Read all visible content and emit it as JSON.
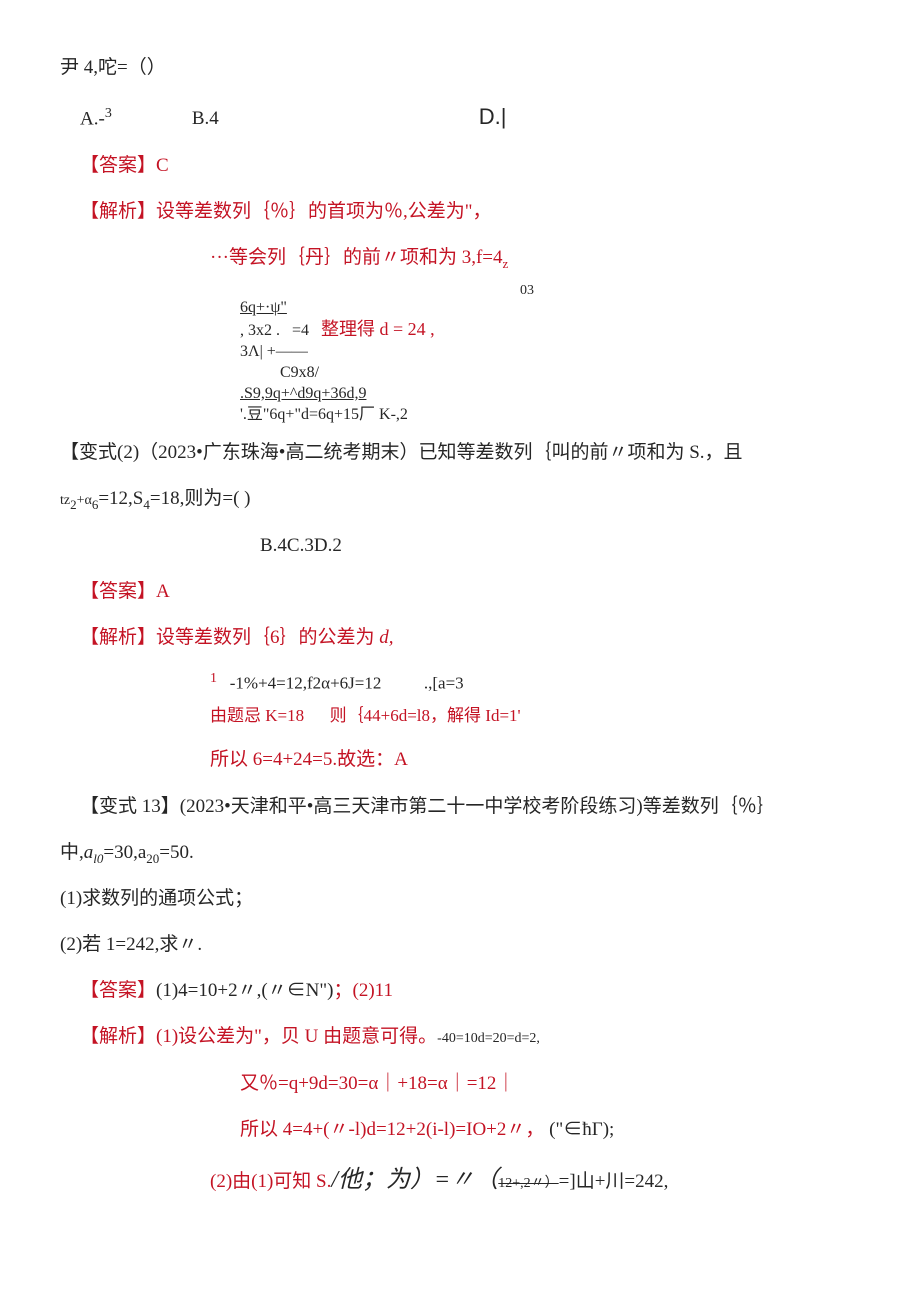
{
  "q1": {
    "stem": "尹 4,咜=（）",
    "optA_pre": "A.-",
    "optA_sup": "3",
    "optB": "B.4",
    "optD": "D.|",
    "ans_label": "【答案】",
    "ans_val": "C",
    "jx_label": "【解析】",
    "jx1": "设等差数列｛％｝的首项为％,公差为\"，",
    "jx2": "···等会列｛丹｝的前〃项和为 3,f=4",
    "sub03": "03",
    "frac1_num": "6q+·ψ\"",
    "calc_a": ",       3x2 .",
    "calc_a_eq": "=4",
    "calc_a_red": "整理得 d = 24 ,",
    "calc_b": "3Λ| +——",
    "calc_c": "C9x8/",
    "calc_d": ".S9,9q+^d9q+36d,9",
    "calc_e": "'.豆\"6q+\"d=6q+15厂 K-,2",
    "z_mark": "z"
  },
  "v12": {
    "head": "【变式(2)（2023•广东珠海•高二统考期末）已知等差数列｛叫的前〃项和为 S.，且",
    "stem2": "=12,S",
    "stem2b": "=18,则为=(              )",
    "sub_tz2": "tz",
    "sub_2": "2",
    "sub_a6": "+α",
    "sub_6": "6",
    "sub_4": "4",
    "opts": "B.4C.3D.2",
    "ans_label": "【答案】",
    "ans_val": "A",
    "jx_label": "【解析】",
    "jx1": "设等差数列｛6｝的公差为",
    "jx1_d": " d,",
    "jx2_a": "由题忌 K=18",
    "jx2_a_sup1": "1",
    "jx2_top": "-1%+4=12,f2α+6J=12",
    "jx2_mid": "则｛44+6d=l8，",
    "jx2_right_top": ".,[a=3",
    "jx2_right_mid": "解得 Id=1'",
    "jx3": "所以 6=4+24=5.",
    "jx3_b": "故选：A"
  },
  "v13": {
    "head": "【变式 13】(2023•天津和平•高三天津市第二十一中学校考阶段练习)等差数列｛％｝",
    "head2_pre": "中,",
    "head2_a": "a",
    "head2_sub1": "l0",
    "head2_mid": "=30,a",
    "head2_sub2": "20",
    "head2_end": "=50.",
    "p1": "(1)求数列的通项公式；",
    "p2": "(2)若 1=242,求〃.",
    "ans_label": "【答案】",
    "ans1": "(1)4=10+2〃,(〃∈N\")",
    "ans_sep": "；",
    "ans2": "(2)11",
    "jx_label": "【解析】",
    "jx1a": "(1)设公差为\"，贝 U 由题意可得。",
    "jx1b": "-40=10d=20=d=2,",
    "jx2": "又％=q+9d=30=α｜+18=α｜=12｜",
    "jx3": "所以 4=4+(〃-l)d=12+2(i-l)=IO+2〃，",
    "jx3b": "(\"∈ħΓ);",
    "jx4a": "(2)由(1)可知 S.",
    "jx4b": "/他；为）=〃（",
    "jx4c": "12+,2〃）",
    "jx4d": "=]山+川=242,"
  }
}
